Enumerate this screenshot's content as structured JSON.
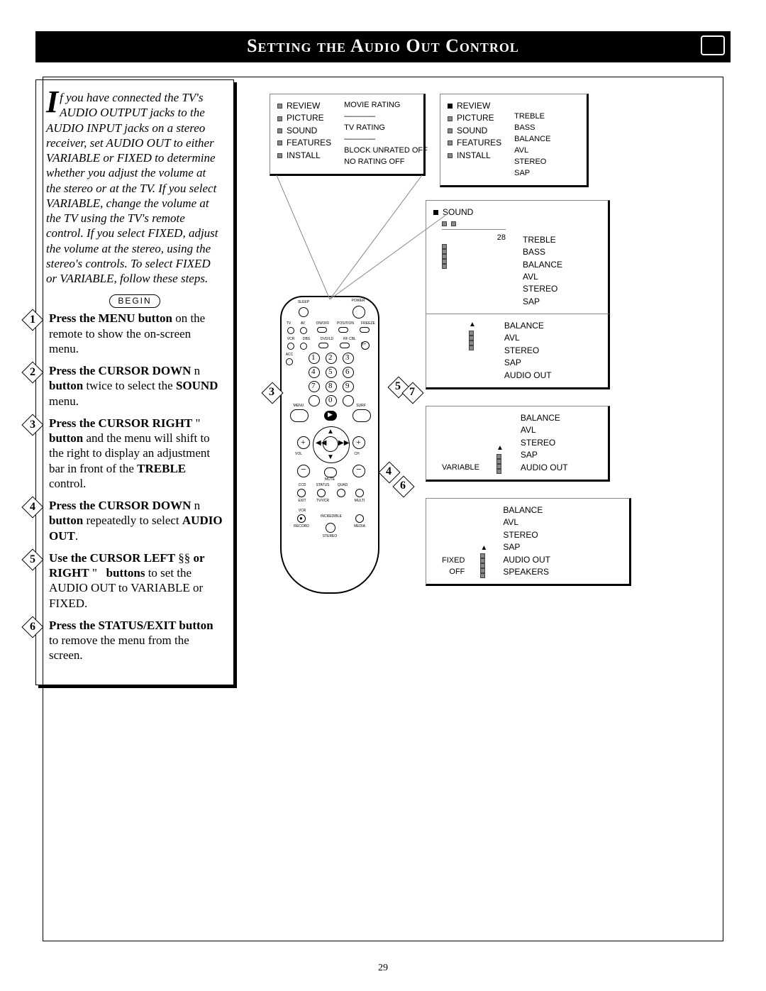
{
  "title": "Setting the Audio Out Control",
  "intro_dropcap": "I",
  "intro_rest": "f you have connected the TV's AUDIO OUTPUT jacks to the AUDIO INPUT jacks on a stereo receiver, set AUDIO OUT to either VARIABLE or FIXED to determine whether you adjust the volume at the stereo or at the TV. If you select VARIABLE, change the volume at the TV using the TV's remote control. If you select FIXED, adjust the volume at the stereo, using the stereo's controls. To select FIXED or VARIABLE, follow these steps.",
  "begin_label": "BEGIN",
  "steps": [
    {
      "num": "1",
      "bold": "Press the MENU button",
      "rest": " on the remote to show the on-screen menu."
    },
    {
      "num": "2",
      "bold": "Press the CURSOR DOWN n button",
      "rest": " twice to select the SOUND menu.",
      "tail_bold": "SOUND"
    },
    {
      "num": "3",
      "bold": "Press the CURSOR RIGHT \"   button",
      "rest": " and the menu will shift to the right to display an adjustment bar in front of the TREBLE control.",
      "tail_bold": "TREBLE"
    },
    {
      "num": "4",
      "bold": "Press the CURSOR DOWN n button",
      "rest": " repeatedly to select AUDIO OUT.",
      "tail_bold": "AUDIO OUT"
    },
    {
      "num": "5",
      "bold": "Use the CURSOR LEFT §§ or RIGHT \"   buttons",
      "rest": " to set the AUDIO OUT to VARIABLE or FIXED."
    },
    {
      "num": "6",
      "bold": "Press the STATUS/EXIT button",
      "rest": " to remove the menu from the screen."
    }
  ],
  "osd": {
    "main_left": {
      "items": [
        "REVIEW",
        "PICTURE",
        "SOUND",
        "FEATURES",
        "INSTALL"
      ],
      "side": [
        "MOVIE RATING",
        "————",
        "TV RATING",
        "————",
        "BLOCK UNRATED OFF",
        "NO RATING   OFF"
      ]
    },
    "main_right": {
      "items": [
        "REVIEW",
        "PICTURE",
        "SOUND",
        "FEATURES",
        "INSTALL"
      ],
      "side": [
        "",
        "TREBLE",
        "BASS",
        "BALANCE",
        "AVL",
        "STEREO",
        "SAP"
      ]
    },
    "sound_box": {
      "title": "SOUND",
      "num": "28",
      "items": [
        "TREBLE",
        "BASS",
        "BALANCE",
        "AVL",
        "STEREO",
        "SAP"
      ]
    },
    "list1": [
      "BALANCE",
      "AVL",
      "STEREO",
      "SAP",
      "AUDIO OUT"
    ],
    "list2": {
      "prefix": "VARIABLE",
      "items": [
        "BALANCE",
        "AVL",
        "STEREO",
        "SAP",
        "AUDIO OUT"
      ]
    },
    "list3": {
      "prefix1": "FIXED",
      "prefix2": "OFF",
      "items": [
        "BALANCE",
        "AVL",
        "STEREO",
        "SAP",
        "AUDIO OUT",
        "SPEAKERS"
      ]
    }
  },
  "remote_labels": {
    "sleep": "SLEEP",
    "power": "POWER",
    "tv": "TV",
    "av": "AV",
    "onoff": "ON/OFF",
    "position": "POSITION",
    "freeze": "FREEZE",
    "vcr": "VCR",
    "dbs": "DBS",
    "dvdld": "DVD/LD",
    "rfcbl": "RF CBL",
    "acc": "ACC",
    "menu": "MENU",
    "surf": "SURF",
    "vol": "VOL",
    "ch": "CH",
    "mute": "MUTE",
    "ccd": "CCD",
    "status": "STATUS",
    "quad": "QUAD",
    "exit": "EXIT",
    "tvvcr": "TV/VCR",
    "multi": "MULTI",
    "vcr2": "VCR",
    "record": "RECORD",
    "incredible": "INCREDIBLE",
    "stereo": "STEREO",
    "media": "MEDIA"
  },
  "callouts": [
    "3",
    "5",
    "7",
    "4",
    "6"
  ],
  "page_number": "29"
}
